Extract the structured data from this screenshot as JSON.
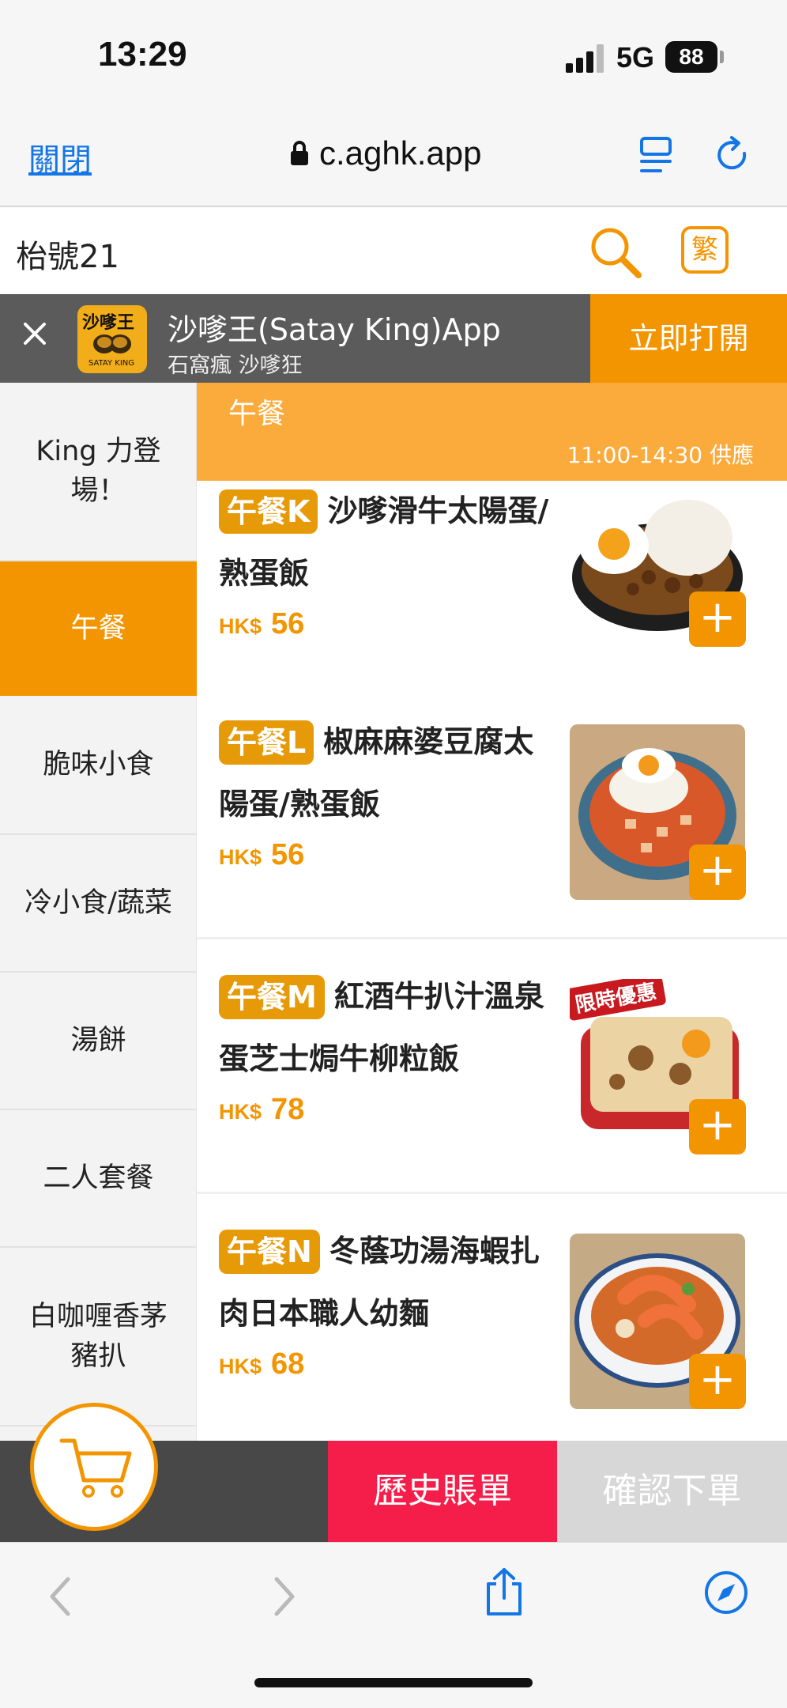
{
  "status_bar": {
    "time": "13:29",
    "network": "5G",
    "battery": "88"
  },
  "browser": {
    "close_label": "關閉",
    "url": "c.aghk.app"
  },
  "header": {
    "table_label": "枱號21",
    "lang_label": "繁"
  },
  "app_banner": {
    "app_name": "沙嗲王(Satay King)App",
    "tagline": "石窩瘋 沙嗲狂",
    "logo_text": "沙嗲王",
    "logo_subtext": "SATAY KING",
    "open_label": "立即打開"
  },
  "sidebar": {
    "items": [
      {
        "label": "King 力登場！",
        "active": false
      },
      {
        "label": "午餐",
        "active": true
      },
      {
        "label": "脆味小食",
        "active": false
      },
      {
        "label": "冷小食/蔬菜",
        "active": false
      },
      {
        "label": "湯餅",
        "active": false
      },
      {
        "label": "二人套餐",
        "active": false
      },
      {
        "label": "白咖喱香茅豬扒",
        "active": false
      }
    ]
  },
  "section": {
    "title": "午餐",
    "hours": "11:00-14:30 供應"
  },
  "menu_items": [
    {
      "code": "午餐K",
      "name": "沙嗲滑牛太陽蛋/熟蛋飯",
      "currency": "HK$",
      "price": "56",
      "photo": "satay-beef-rice"
    },
    {
      "code": "午餐L",
      "name": "椒麻麻婆豆腐太陽蛋/熟蛋飯",
      "currency": "HK$",
      "price": "56",
      "photo": "mapo-tofu-rice"
    },
    {
      "code": "午餐M",
      "name": "紅酒牛扒汁溫泉蛋芝士焗牛柳粒飯",
      "currency": "HK$",
      "price": "78",
      "photo": "baked-beef-rice",
      "badge": "限時優惠"
    },
    {
      "code": "午餐N",
      "name": "冬蔭功湯海蝦扎肉日本職人幼麵",
      "currency": "HK$",
      "price": "68",
      "photo": "tomyum-noodle"
    }
  ],
  "action_bar": {
    "history_label": "歷史賬單",
    "confirm_label": "確認下單"
  },
  "colors": {
    "accent": "#f39500",
    "section_header": "#fbab3c",
    "history": "#f51e4a",
    "link": "#1476e6"
  }
}
